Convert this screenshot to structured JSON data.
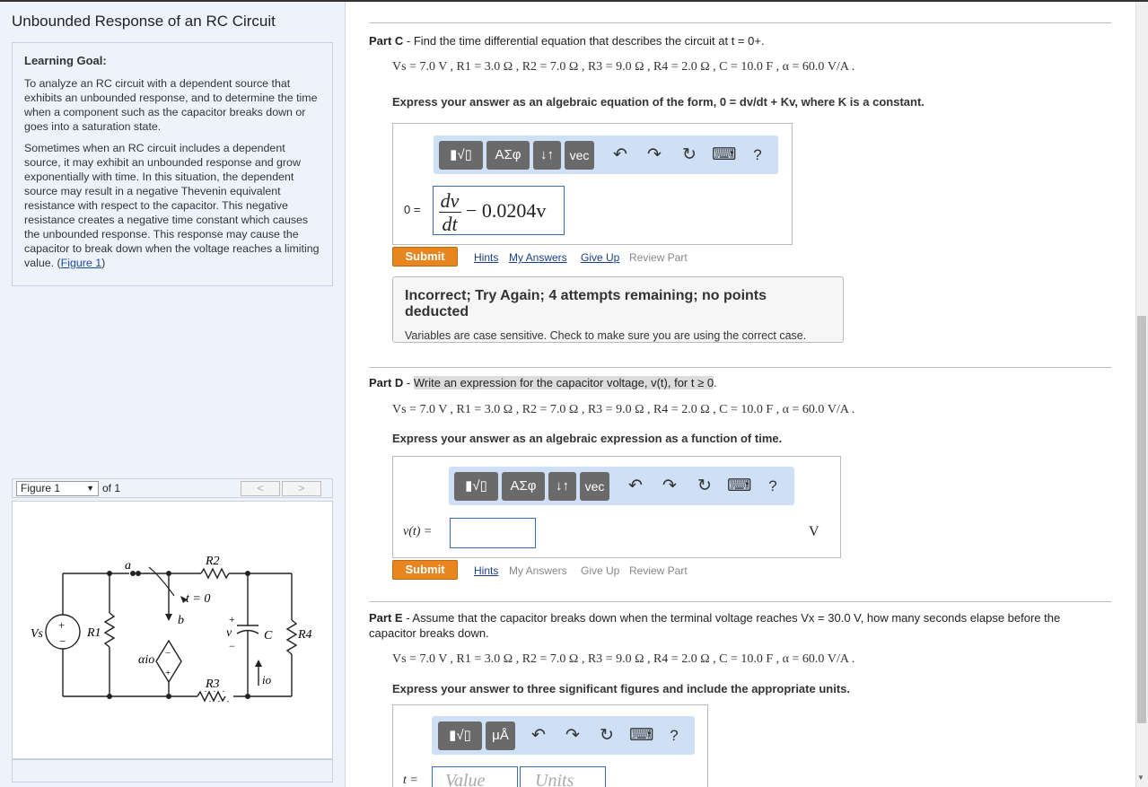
{
  "left": {
    "title": "Unbounded Response of an RC Circuit",
    "goal_title": "Learning Goal:",
    "goal_p1": "To analyze an RC circuit with a dependent source that exhibits an unbounded response, and to determine the time when a component such as the capacitor breaks down or goes into a saturation state.",
    "goal_p2": "Sometimes when an RC circuit includes a dependent source, it may exhibit an unbounded response and grow exponentially with time. In this situation, the dependent source may result in a negative Thevenin equivalent resistance with respect to the capacitor. This negative resistance creates a negative time constant which causes the unbounded response. This response may cause the capacitor to break down when the voltage reaches a limiting value. (",
    "goal_link": "Figure 1",
    "goal_close": ")",
    "figure_select": "Figure 1",
    "figure_of": "of 1",
    "prev": "<",
    "next": ">"
  },
  "circuit": {
    "a": "a",
    "b": "b",
    "t0": "t = 0",
    "r1": "R1",
    "r2": "R2",
    "r3": "R3",
    "r4": "R4",
    "vs": "Vs",
    "c": "C",
    "v": "v",
    "io": "io",
    "aio": "αio",
    "plus": "+",
    "minus": "−"
  },
  "params": "Vs = 7.0 V , R1 = 3.0 Ω , R2 = 7.0 Ω , R3 = 9.0 Ω , R4 = 2.0 Ω , C = 10.0 F , α = 60.0 V/A .",
  "partC": {
    "label": "Part C",
    "text": " - Find the time differential equation that describes the circuit at t = 0+.",
    "instr": "Express your answer as an algebraic equation of the form, 0 = dv/dt + Kv, where K is a constant.",
    "lhs": "0 =",
    "ans_num": "dv",
    "ans_den": "dt",
    "ans_rest": "− 0.0204v",
    "submit": "Submit",
    "hints": "Hints",
    "my_answers": "My Answers",
    "give_up": "Give Up",
    "review": "Review Part",
    "fb_title": "Incorrect; Try Again; 4 attempts remaining; no points deducted",
    "fb_text": "Variables are case sensitive. Check to make sure you are using the correct case."
  },
  "partD": {
    "label": "Part D",
    "text": "Write an expression for the capacitor voltage, v(t), for t ≥ 0",
    "instr": "Express your answer as an algebraic expression as a function of time.",
    "lhs": "v(t) =",
    "unit": "V",
    "submit": "Submit",
    "hints": "Hints",
    "my_answers": "My Answers",
    "give_up": "Give Up",
    "review": "Review Part"
  },
  "partE": {
    "label": "Part E",
    "text": " - Assume that the capacitor breaks down when the terminal voltage reaches Vx = 30.0 V, how many seconds elapse before the capacitor breaks down.",
    "instr": "Express your answer to three significant figures and include the appropriate units.",
    "lhs": "t =",
    "value_ph": "Value",
    "units_ph": "Units"
  },
  "toolbar": {
    "templates": "▮√▯",
    "greek": "ΑΣφ",
    "arrows": "↓↑",
    "vec": "vec",
    "undo": "↶",
    "redo": "↷",
    "reset": "↻",
    "keyboard": "⌨",
    "help": "?",
    "units_btn": "μÅ"
  }
}
